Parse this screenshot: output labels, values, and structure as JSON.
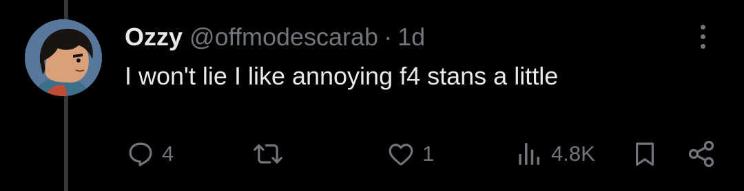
{
  "tweet": {
    "author": {
      "display_name": "Ozzy",
      "handle": "@offmodescarab",
      "separator": "·",
      "time": "1d"
    },
    "text": "I won't lie I like annoying f4 stans a little",
    "actions": {
      "reply": {
        "icon": "reply-icon",
        "count": "4"
      },
      "retweet": {
        "icon": "retweet-icon",
        "count": ""
      },
      "like": {
        "icon": "heart-icon",
        "count": "1"
      },
      "views": {
        "icon": "views-icon",
        "count": "4.8K"
      },
      "bookmark": {
        "icon": "bookmark-icon"
      },
      "share": {
        "icon": "share-icon"
      }
    },
    "more": {
      "icon": "more-vertical-icon"
    }
  },
  "colors": {
    "background": "#000000",
    "primary_text": "#e7e9ea",
    "secondary_text": "#71767b",
    "thread_line": "#333639"
  }
}
